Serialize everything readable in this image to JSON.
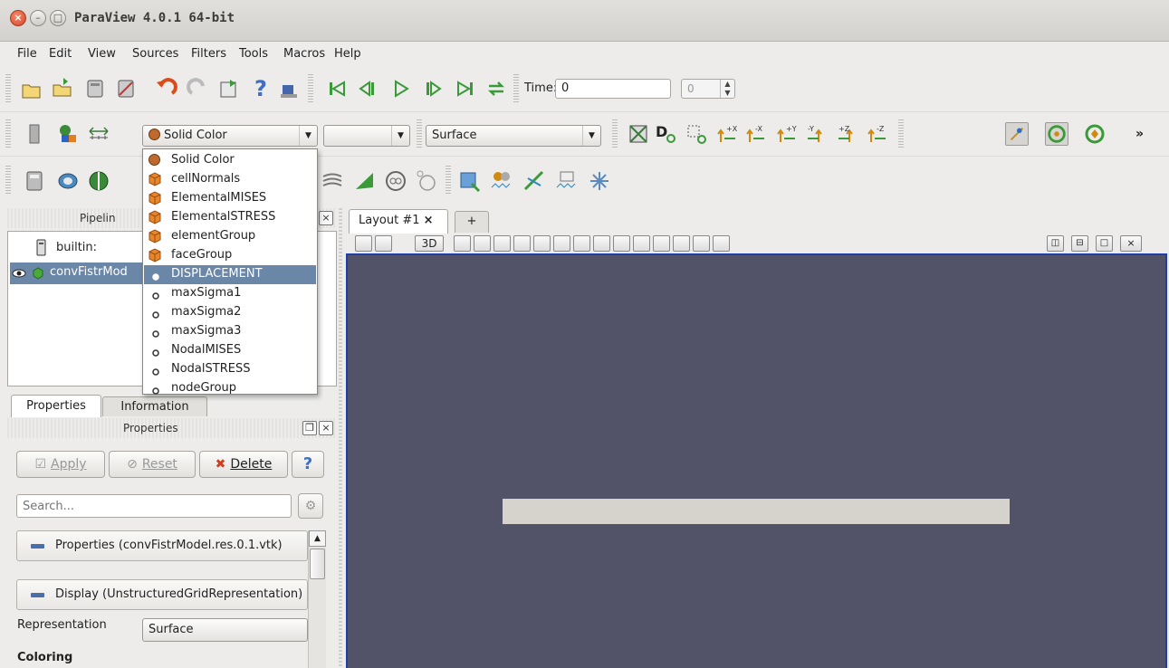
{
  "window": {
    "title": "ParaView 4.0.1 64-bit"
  },
  "menubar": [
    {
      "label": "File",
      "key": "F"
    },
    {
      "label": "Edit",
      "key": "E"
    },
    {
      "label": "View",
      "key": "V"
    },
    {
      "label": "Sources",
      "key": "S"
    },
    {
      "label": "Filters",
      "key": "F"
    },
    {
      "label": "Tools",
      "key": "T"
    },
    {
      "label": "Macros",
      "key": "M"
    },
    {
      "label": "Help",
      "key": "H"
    }
  ],
  "time": {
    "label": "Time:",
    "value": "0",
    "step_value": "0"
  },
  "coloring_combo": {
    "selected": "Solid Color"
  },
  "representation_combo": {
    "selected": "Surface"
  },
  "dropdown": {
    "items": [
      {
        "label": "Solid Color",
        "icon": "solid-color-icon"
      },
      {
        "label": "cellNormals",
        "icon": "cell-data-icon"
      },
      {
        "label": "ElementalMISES",
        "icon": "cell-data-icon"
      },
      {
        "label": "ElementalSTRESS",
        "icon": "cell-data-icon"
      },
      {
        "label": "elementGroup",
        "icon": "cell-data-icon"
      },
      {
        "label": "faceGroup",
        "icon": "cell-data-icon"
      },
      {
        "label": "DISPLACEMENT",
        "icon": "point-data-icon",
        "selected": true
      },
      {
        "label": "maxSigma1",
        "icon": "point-data-icon"
      },
      {
        "label": "maxSigma2",
        "icon": "point-data-icon"
      },
      {
        "label": "maxSigma3",
        "icon": "point-data-icon"
      },
      {
        "label": "NodalMISES",
        "icon": "point-data-icon"
      },
      {
        "label": "NodalSTRESS",
        "icon": "point-data-icon"
      },
      {
        "label": "nodeGroup",
        "icon": "point-data-icon"
      }
    ]
  },
  "pipeline": {
    "title": "Pipelin",
    "items": [
      "builtin:",
      "convFistrMod"
    ]
  },
  "tabs": {
    "properties": "Properties",
    "information": "Information"
  },
  "properties_panel": {
    "title": "Properties",
    "apply": "Apply",
    "reset": "Reset",
    "delete": "Delete",
    "help": "?",
    "search_placeholder": "Search...",
    "section_properties": "Properties (convFistrModel.res.0.1.vtk)",
    "section_display": "Display (UnstructuredGridRepresentation)",
    "representation_label": "Representation",
    "representation_value": "Surface",
    "coloring_label": "Coloring"
  },
  "layout": {
    "tab_label": "Layout #1",
    "tab_close": "×",
    "add_tab": "+",
    "btn_3d": "3D"
  },
  "toolbar_misc": {
    "more": "»"
  },
  "colors": {
    "viewport_bg": "#525369",
    "selection": "#6b87a8",
    "border_active": "#1e3ea8"
  }
}
